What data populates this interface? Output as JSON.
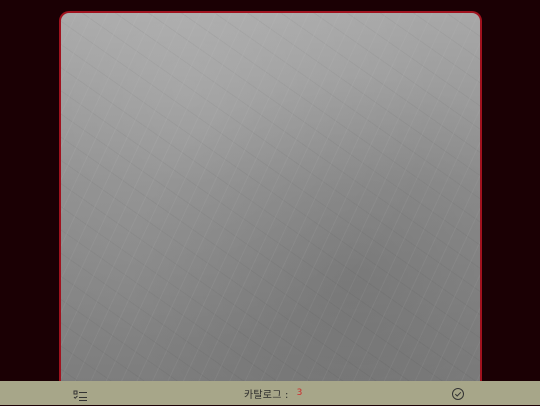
{
  "colors": {
    "background": "#1b0004",
    "frame_border": "#a0121e",
    "bottom_bar": "#a7a689",
    "count_text": "#cc2b2b"
  },
  "image_panel": {
    "content": "gray-textured-surface"
  },
  "bottom_bar": {
    "left_icon": "checklist-icon",
    "catalog_label": "카탈로그 :",
    "catalog_count": "3",
    "right_icon": "check-circle-icon"
  }
}
